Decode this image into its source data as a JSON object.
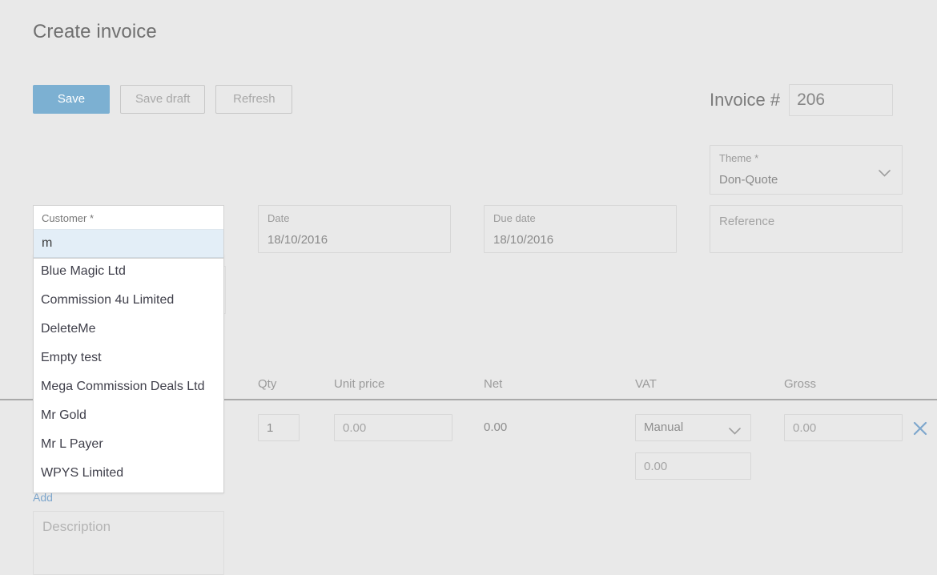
{
  "page": {
    "title": "Create invoice"
  },
  "toolbar": {
    "save_label": "Save",
    "save_draft_label": "Save draft",
    "refresh_label": "Refresh"
  },
  "invoice": {
    "number_label": "Invoice #",
    "number_value": "206"
  },
  "theme": {
    "label": "Theme *",
    "value": "Don-Quote"
  },
  "customer": {
    "label": "Customer *",
    "value": "m",
    "placeholder": "",
    "suggestions": [
      "Blue Magic Ltd",
      "Commission 4u Limited",
      "DeleteMe",
      "Empty test",
      "Mega Commission Deals Ltd",
      "Mr Gold",
      "Mr L Payer",
      "WPYS Limited"
    ]
  },
  "date": {
    "label": "Date",
    "value": "18/10/2016"
  },
  "due_date": {
    "label": "Due date",
    "value": "18/10/2016"
  },
  "reference": {
    "placeholder": "Reference",
    "value": ""
  },
  "line_items": {
    "columns": {
      "qty": "Qty",
      "unit_price": "Unit price",
      "net": "Net",
      "vat": "VAT",
      "gross": "Gross"
    },
    "rows": [
      {
        "qty": "1",
        "unit_price_placeholder": "0.00",
        "unit_price": "",
        "net": "0.00",
        "vat_mode": "Manual",
        "vat_amount_placeholder": "0.00",
        "vat_amount": "",
        "gross_placeholder": "0.00",
        "gross": "",
        "remove_label": "×"
      }
    ],
    "add_label": "Add"
  },
  "description": {
    "placeholder": "Description",
    "value": ""
  },
  "colors": {
    "accent": "#7cb0d2",
    "background": "#e9e9e9",
    "link": "#7ea7cd",
    "input_focus_bg": "#e3eef7",
    "divider": "#a9a9a9"
  },
  "icons": {
    "chevron_down": "chevron-down-icon",
    "close": "close-icon"
  }
}
